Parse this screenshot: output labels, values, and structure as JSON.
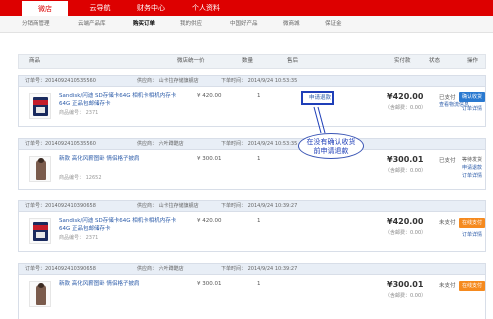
{
  "topnav": {
    "tabs": [
      "微店",
      "云导航",
      "财务中心",
      "个人资料"
    ]
  },
  "subnav": {
    "items": [
      "分销商管理",
      "云端产品库",
      "购买订单",
      "我的供应",
      "中国好产品",
      "微商城",
      "保证金"
    ]
  },
  "table_header": {
    "product": "商品",
    "unit_price": "微店统一价",
    "quantity": "数量",
    "after_sale": "售后",
    "paid": "实付款",
    "status": "状态",
    "action": "操作"
  },
  "orders": [
    {
      "order_no": "订单号：2014092410535560",
      "supplier": "供应商：  山卡拉存储旗舰店",
      "time": "下单时间：  2014/9/24 10:53:35",
      "product_name": "Sandisk/闪迪 SD存储卡64G 相机卡相机内存卡64G 正品包邮储存卡",
      "product_code": "商品编号：  2371",
      "unit_price": "¥ 420.00",
      "quantity": "1",
      "after_sale": "申请退款",
      "total": "¥420.00",
      "shipping": "（含邮费：0.00）",
      "status": "已支付",
      "status_link": "查看物流信息",
      "button": "确认收货",
      "detail_link": "订单详情"
    },
    {
      "order_no": "订单号：2014092410535560",
      "supplier": "供应商：  六叶蹲酷店",
      "time": "下单时间：  2014/9/24 10:53:35",
      "product_name": "新款 高化风薪图卧 情侣格子披肩",
      "product_code": "商品编号：  12652",
      "unit_price": "¥ 300.01",
      "quantity": "1",
      "total": "¥300.01",
      "shipping": "（含邮费：0.00）",
      "status": "已支付",
      "action_1": "等待发货",
      "action_2": "申请退款",
      "detail_link": "订单详情"
    },
    {
      "order_no": "订单号：2014092410390658",
      "supplier": "供应商：  山卡拉存储旗舰店",
      "time": "下单时间：  2014/9/24 10:39:27",
      "product_name": "Sandisk/闪迪 SD存储卡64G 相机卡相机内存卡64G 正品包邮储存卡",
      "product_code": "商品编号：  2371",
      "unit_price": "¥ 420.00",
      "quantity": "1",
      "total": "¥420.00",
      "shipping": "（含邮费：0.00）",
      "status": "未支付",
      "button": "在线支付",
      "detail_link": "订单详情"
    },
    {
      "order_no": "订单号：2014092410390658",
      "supplier": "供应商：  六叶蹲酷店",
      "time": "下单时间：  2014/9/24 10:39:27",
      "product_name": "新款 高化风薪图卧 情侣格子披肩",
      "product_code": "",
      "unit_price": "¥ 300.01",
      "quantity": "1",
      "total": "¥300.01",
      "shipping": "（含邮费：0.00）",
      "status": "未支付",
      "button": "在线支付"
    }
  ],
  "annotation": {
    "line1": "在没有确认收货",
    "line2": "前申请退款"
  },
  "colors": {
    "brand_red": "#dd0000",
    "link_blue": "#2a5aa8",
    "button_blue": "#2a79d0",
    "button_orange": "#f58a1f",
    "annotation_blue": "#1f3fb8"
  }
}
